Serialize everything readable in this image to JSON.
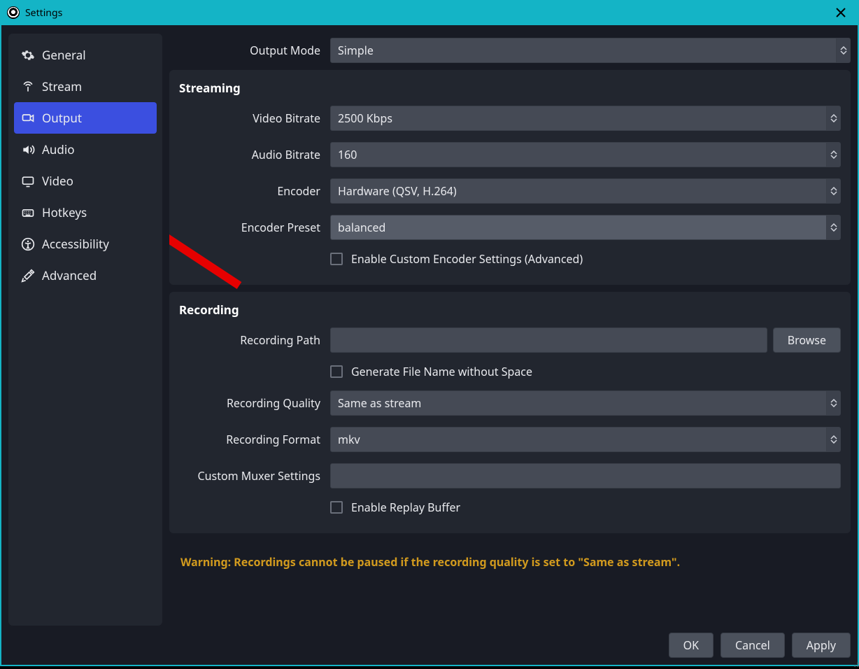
{
  "window": {
    "title": "Settings"
  },
  "sidebar": {
    "items": [
      {
        "id": "general",
        "label": "General"
      },
      {
        "id": "stream",
        "label": "Stream"
      },
      {
        "id": "output",
        "label": "Output",
        "active": true
      },
      {
        "id": "audio",
        "label": "Audio"
      },
      {
        "id": "video",
        "label": "Video"
      },
      {
        "id": "hotkeys",
        "label": "Hotkeys"
      },
      {
        "id": "accessibility",
        "label": "Accessibility"
      },
      {
        "id": "advanced",
        "label": "Advanced"
      }
    ]
  },
  "output": {
    "mode_label": "Output Mode",
    "mode_value": "Simple",
    "streaming": {
      "title": "Streaming",
      "video_bitrate_label": "Video Bitrate",
      "video_bitrate_value": "2500 Kbps",
      "audio_bitrate_label": "Audio Bitrate",
      "audio_bitrate_value": "160",
      "encoder_label": "Encoder",
      "encoder_value": "Hardware (QSV, H.264)",
      "encoder_preset_label": "Encoder Preset",
      "encoder_preset_value": "balanced",
      "enable_custom_label": "Enable Custom Encoder Settings (Advanced)"
    },
    "recording": {
      "title": "Recording",
      "path_label": "Recording Path",
      "path_value": "",
      "browse_label": "Browse",
      "gen_filename_label": "Generate File Name without Space",
      "quality_label": "Recording Quality",
      "quality_value": "Same as stream",
      "format_label": "Recording Format",
      "format_value": "mkv",
      "muxer_label": "Custom Muxer Settings",
      "muxer_value": "",
      "replay_label": "Enable Replay Buffer"
    },
    "warning": "Warning: Recordings cannot be paused if the recording quality is set to \"Same as stream\"."
  },
  "footer": {
    "ok": "OK",
    "cancel": "Cancel",
    "apply": "Apply"
  }
}
